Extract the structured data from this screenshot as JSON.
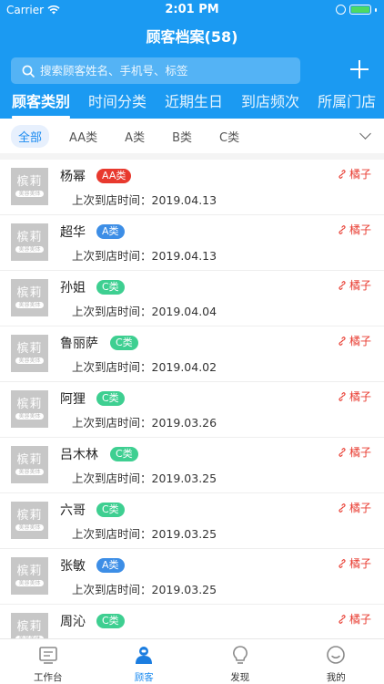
{
  "status_bar": {
    "carrier": "Carrier",
    "time": "2:01 PM"
  },
  "nav": {
    "title": "顾客档案(58)"
  },
  "search": {
    "placeholder": "搜索顾客姓名、手机号、标签"
  },
  "tabs": [
    {
      "label": "顾客类别",
      "active": true
    },
    {
      "label": "时间分类",
      "active": false
    },
    {
      "label": "近期生日",
      "active": false
    },
    {
      "label": "到店频次",
      "active": false
    },
    {
      "label": "所属门店",
      "active": false
    }
  ],
  "filters": [
    {
      "label": "全部",
      "active": true
    },
    {
      "label": "AA类",
      "active": false
    },
    {
      "label": "A类",
      "active": false
    },
    {
      "label": "B类",
      "active": false
    },
    {
      "label": "C类",
      "active": false
    }
  ],
  "avatar": {
    "main": "槟莉",
    "sub": "美容美体"
  },
  "visit_label": "上次到店时间：",
  "customers": [
    {
      "name": "杨幂",
      "badge": "AA类",
      "badge_type": "aa",
      "date": "2019.04.13",
      "link": "橘子"
    },
    {
      "name": "超华",
      "badge": "A类",
      "badge_type": "a",
      "date": "2019.04.13",
      "link": "橘子"
    },
    {
      "name": "孙姐",
      "badge": "C类",
      "badge_type": "c",
      "date": "2019.04.04",
      "link": "橘子"
    },
    {
      "name": "鲁丽萨",
      "badge": "C类",
      "badge_type": "c",
      "date": "2019.04.02",
      "link": "橘子"
    },
    {
      "name": "阿狸",
      "badge": "C类",
      "badge_type": "c",
      "date": "2019.03.26",
      "link": "橘子"
    },
    {
      "name": "吕木林",
      "badge": "C类",
      "badge_type": "c",
      "date": "2019.03.25",
      "link": "橘子"
    },
    {
      "name": "六哥",
      "badge": "C类",
      "badge_type": "c",
      "date": "2019.03.25",
      "link": "橘子"
    },
    {
      "name": "张敏",
      "badge": "A类",
      "badge_type": "a",
      "date": "2019.03.25",
      "link": "橘子"
    },
    {
      "name": "周沁",
      "badge": "C类",
      "badge_type": "c",
      "date": "",
      "link": "橘子"
    }
  ],
  "tabbar": [
    {
      "label": "工作台",
      "icon": "workbench-icon",
      "active": false
    },
    {
      "label": "顾客",
      "icon": "customer-icon",
      "active": true
    },
    {
      "label": "发现",
      "icon": "discover-icon",
      "active": false
    },
    {
      "label": "我的",
      "icon": "profile-icon",
      "active": false
    }
  ],
  "colors": {
    "primary": "#1b9af2",
    "badge_aa": "#e8392e",
    "badge_a": "#3d8ee6",
    "badge_c": "#3ecf91",
    "link": "#e8392e"
  }
}
